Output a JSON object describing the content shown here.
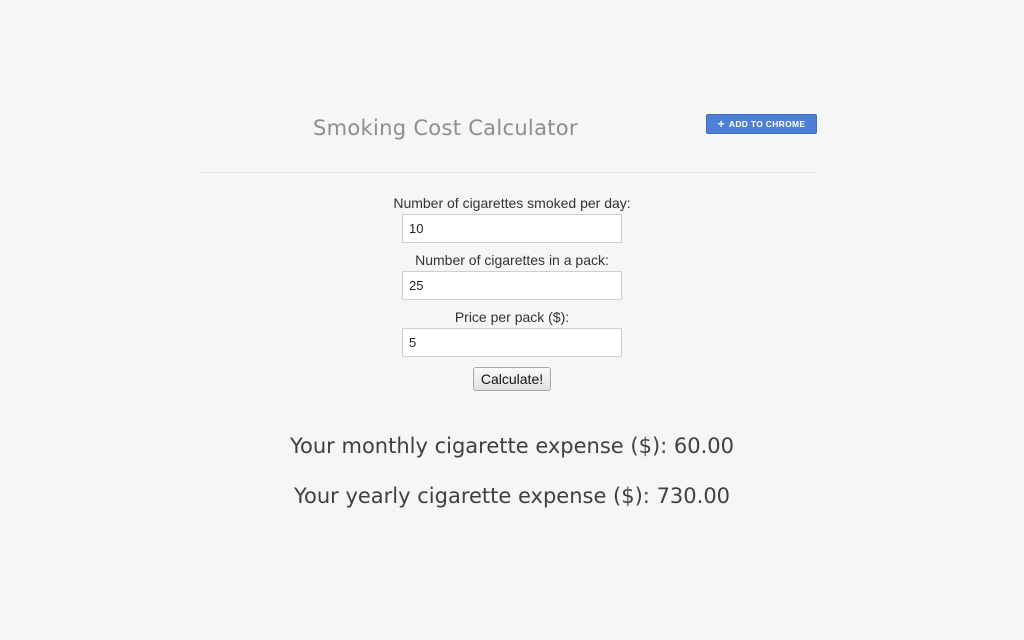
{
  "app": {
    "title": "Smoking Cost Calculator",
    "chrome_button_label": "ADD TO CHROME",
    "chrome_button_icon": "plus-icon"
  },
  "form": {
    "fields": [
      {
        "label": "Number of cigarettes smoked per day:",
        "value": "10"
      },
      {
        "label": "Number of cigarettes in a pack:",
        "value": "25"
      },
      {
        "label": "Price per pack ($):",
        "value": "5"
      }
    ],
    "submit_label": "Calculate!"
  },
  "results": {
    "monthly_label": "Your monthly cigarette expense ($): ",
    "monthly_value": "60.00",
    "yearly_label": "Your yearly cigarette expense ($): ",
    "yearly_value": "730.00"
  },
  "colors": {
    "background": "#f6f6f6",
    "chrome_button": "#4d7fd6"
  }
}
